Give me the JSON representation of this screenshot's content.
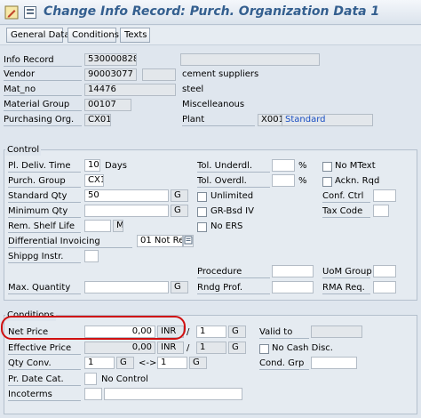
{
  "window": {
    "title": "Change Info Record: Purch. Organization Data 1"
  },
  "tabs": [
    "General Data",
    "Conditions",
    "Texts"
  ],
  "header": {
    "info_record": {
      "label": "Info Record",
      "value": "5300008281"
    },
    "vendor": {
      "label": "Vendor",
      "value": "90003077",
      "desc": "cement suppliers"
    },
    "mat_no": {
      "label": "Mat_no",
      "value": "14476",
      "desc": "steel"
    },
    "material_group": {
      "label": "Material Group",
      "value": "00107",
      "desc": "Miscelleanous"
    },
    "purchasing_org": {
      "label": "Purchasing Org.",
      "value": "CX01"
    },
    "plant": {
      "label": "Plant",
      "value": "X001",
      "desc": "Standard"
    }
  },
  "control": {
    "title": "Control",
    "pl_deliv_time": {
      "label": "Pl. Deliv. Time",
      "value": "10",
      "unit": "Days"
    },
    "purch_group": {
      "label": "Purch. Group",
      "value": "CX1"
    },
    "standard_qty": {
      "label": "Standard Qty",
      "value": "50",
      "unit": "G"
    },
    "minimum_qty": {
      "label": "Minimum Qty",
      "unit": "G"
    },
    "rem_shelf_life": {
      "label": "Rem. Shelf Life",
      "unit": "M"
    },
    "differential_invoicing": {
      "label": "Differential Invoicing",
      "value": "01 Not Re..."
    },
    "shippg_instr": {
      "label": "Shippg Instr."
    },
    "max_quantity": {
      "label": "Max. Quantity",
      "unit": "G"
    },
    "tol_underdl": {
      "label": "Tol. Underdl.",
      "unit": "%"
    },
    "tol_overdl": {
      "label": "Tol. Overdl.",
      "unit": "%"
    },
    "unlimited": "Unlimited",
    "gr_bsd_iv": "GR-Bsd IV",
    "no_ers": "No ERS",
    "procedure": "Procedure",
    "rndg_prof": "Rndg Prof.",
    "no_mtext": "No MText",
    "ackn_rqd": "Ackn. Rqd",
    "conf_ctrl": "Conf. Ctrl",
    "tax_code": "Tax Code",
    "uom_group": "UoM Group",
    "rma_req": "RMA Req."
  },
  "conditions": {
    "title": "Conditions",
    "net_price": {
      "label": "Net Price",
      "value": "0,00",
      "currency": "INR",
      "per": "1",
      "unit": "G"
    },
    "effective_price": {
      "label": "Effective Price",
      "value": "0,00",
      "currency": "INR",
      "per": "1",
      "unit": "G"
    },
    "qty_conv": {
      "label": "Qty Conv.",
      "from_qty": "1",
      "from_unit": "G",
      "arrow": "<->",
      "to_qty": "1",
      "to_unit": "G"
    },
    "pr_date_cat": {
      "label": "Pr. Date Cat.",
      "value": "No Control"
    },
    "incoterms": {
      "label": "Incoterms"
    },
    "valid_to": "Valid to",
    "no_cash_disc": "No Cash Disc.",
    "cond_grp": "Cond. Grp"
  }
}
